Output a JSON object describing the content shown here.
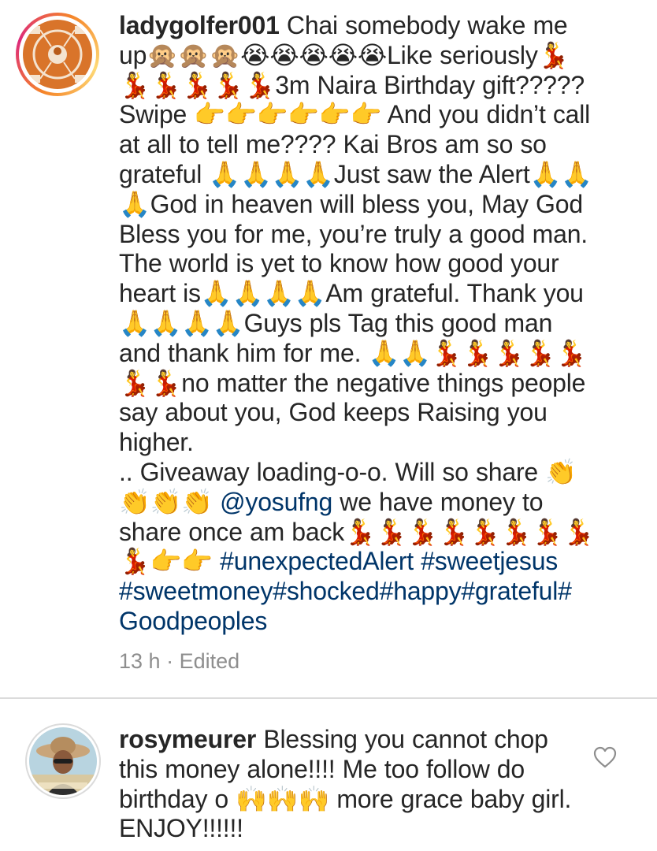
{
  "comment1": {
    "username": "ladygolfer001",
    "lines": [
      "Chai somebody wake me",
      "up🙊🙊🙊😭😭😭😭😭Like seriously💃",
      "💃💃💃💃💃3m Naira Birthday gift?????",
      "Swipe 👉👉👉👉👉👉 And you didn’t call",
      "at all to tell me???? Kai Bros am so so",
      "grateful 🙏🙏🙏🙏Just saw the Alert🙏🙏",
      "🙏God in heaven will bless you, May God",
      "Bless you for me, you’re truly a good man.",
      "The world is yet to know how good your",
      "heart is🙏🙏🙏🙏Am grateful. Thank you",
      "🙏🙏🙏🙏Guys pls Tag this good man",
      "and thank him for me. 🙏🙏💃💃💃💃💃",
      "💃💃no matter the negative things people",
      "say about you, God keeps Raising you",
      "higher.",
      ".. Giveaway loading-o-o. Will so share 👏",
      "👏👏👏 @yosufng we have money to",
      "share once am back💃💃💃💃💃💃💃💃",
      "💃👉👉 #unexpectedAlert #sweetjesus",
      "#sweetmoney#shocked#happy#grateful#",
      "Goodpeoples"
    ],
    "time": "13 h",
    "separator": "·",
    "edited": "Edited"
  },
  "comment2": {
    "username": "rosymeurer",
    "lines": [
      "Blessing you cannot chop",
      "this money alone!!!! Me too follow do",
      "birthday o 🙌🙌🙌 more grace baby girl.",
      "ENJOY!!!!!!"
    ]
  },
  "icons": {
    "like": "heart-outline-icon"
  },
  "colors": {
    "text": "#262626",
    "hashtag": "#003569",
    "meta": "#8e8e8e",
    "divider": "#dbdbdb"
  }
}
